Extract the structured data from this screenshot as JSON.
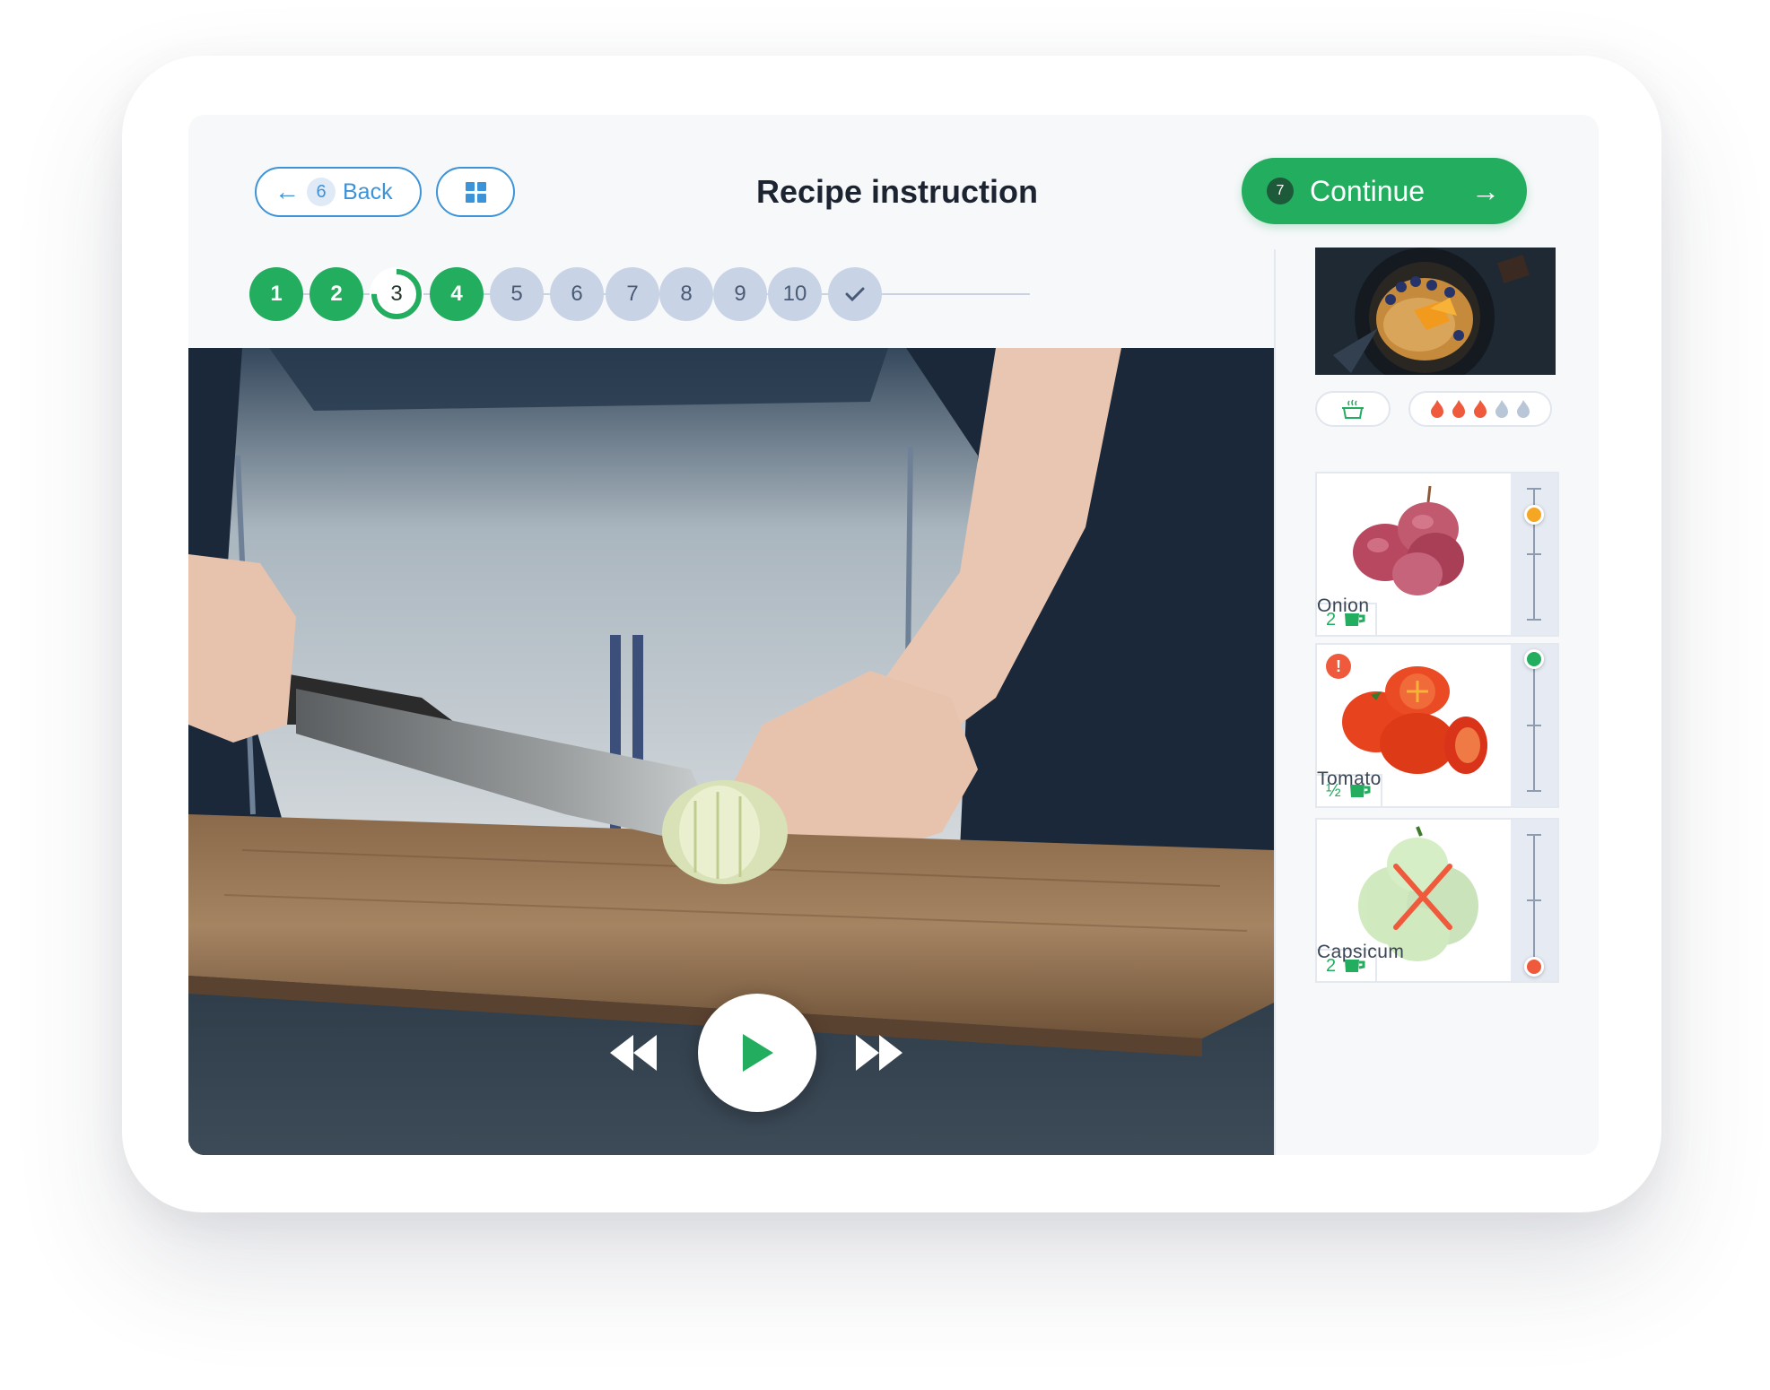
{
  "header": {
    "back_label": "Back",
    "back_step": "6",
    "title": "Recipe instruction",
    "continue_label": "Continue",
    "continue_step": "7"
  },
  "steps": [
    {
      "label": "1",
      "state": "done"
    },
    {
      "label": "2",
      "state": "done"
    },
    {
      "label": "3",
      "state": "current",
      "progress": 0.75
    },
    {
      "label": "4",
      "state": "done"
    },
    {
      "label": "5",
      "state": "todo"
    },
    {
      "label": "6",
      "state": "todo"
    },
    {
      "label": "7",
      "state": "todo"
    },
    {
      "label": "8",
      "state": "todo"
    },
    {
      "label": "9",
      "state": "todo"
    },
    {
      "label": "10",
      "state": "todo"
    },
    {
      "label": "",
      "state": "todo",
      "icon": "check-icon"
    }
  ],
  "heat": {
    "level": 3,
    "max": 5
  },
  "ingredients": [
    {
      "name": "Onion",
      "quantity": "2",
      "unit_icon": "cup-icon",
      "slider_level": 0.8,
      "status": "normal",
      "knob_color": "#f5a623"
    },
    {
      "name": "Tomato",
      "quantity": "½",
      "unit_icon": "cup-icon",
      "slider_level": 1.0,
      "status": "warning",
      "knob_color": "#23ad5f"
    },
    {
      "name": "Capsicum",
      "quantity": "2",
      "unit_icon": "cup-icon",
      "slider_level": 0.0,
      "status": "excluded",
      "knob_color": "#ef5a3c"
    }
  ],
  "colors": {
    "accent": "#23ad5f",
    "link": "#3d93d8",
    "warning": "#ef5a3c",
    "pending": "#c8d4e6"
  }
}
